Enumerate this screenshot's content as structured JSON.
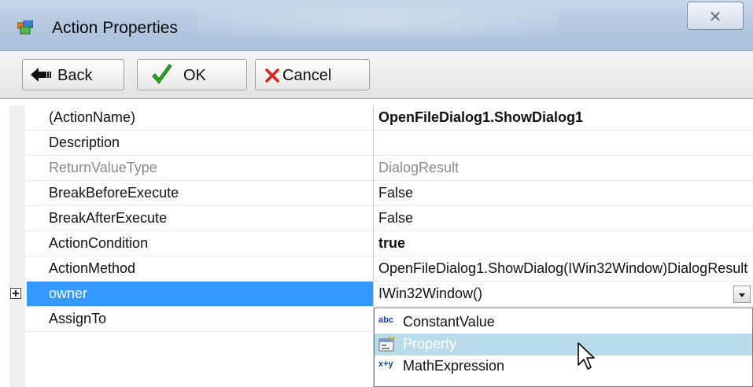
{
  "window": {
    "title": "Action Properties",
    "close_glyph": "✕"
  },
  "toolbar": {
    "back_label": "Back",
    "ok_label": "OK",
    "cancel_label": "Cancel"
  },
  "properties": [
    {
      "name": "(ActionName)",
      "value": "OpenFileDialog1.ShowDialog1",
      "bold": true,
      "disabled": false
    },
    {
      "name": "Description",
      "value": "",
      "bold": false,
      "disabled": false
    },
    {
      "name": "ReturnValueType",
      "value": "DialogResult",
      "bold": false,
      "disabled": true
    },
    {
      "name": "BreakBeforeExecute",
      "value": "False",
      "bold": false,
      "disabled": false
    },
    {
      "name": "BreakAfterExecute",
      "value": "False",
      "bold": false,
      "disabled": false
    },
    {
      "name": "ActionCondition",
      "value": "true",
      "bold": true,
      "disabled": false
    },
    {
      "name": "ActionMethod",
      "value": "OpenFileDialog1.ShowDialog(IWin32Window)DialogResult",
      "bold": false,
      "disabled": false
    },
    {
      "name": "owner",
      "value": "IWin32Window()",
      "bold": false,
      "disabled": false,
      "selected": true,
      "expandable": true
    },
    {
      "name": "AssignTo",
      "value": "",
      "bold": false,
      "disabled": false
    }
  ],
  "dropdown": {
    "items": [
      {
        "icon": "abc",
        "label": "ConstantValue",
        "icon_name": "constant-value-icon"
      },
      {
        "icon": "",
        "label": "Property",
        "icon_name": "property-icon",
        "hover": true
      },
      {
        "icon": "x+y",
        "label": "MathExpression",
        "icon_name": "math-expression-icon"
      }
    ]
  },
  "colors": {
    "selection": "#3399ff",
    "hover": "#b9dcea",
    "ok_check": "#2aa81e",
    "cancel_x": "#e0201b"
  }
}
